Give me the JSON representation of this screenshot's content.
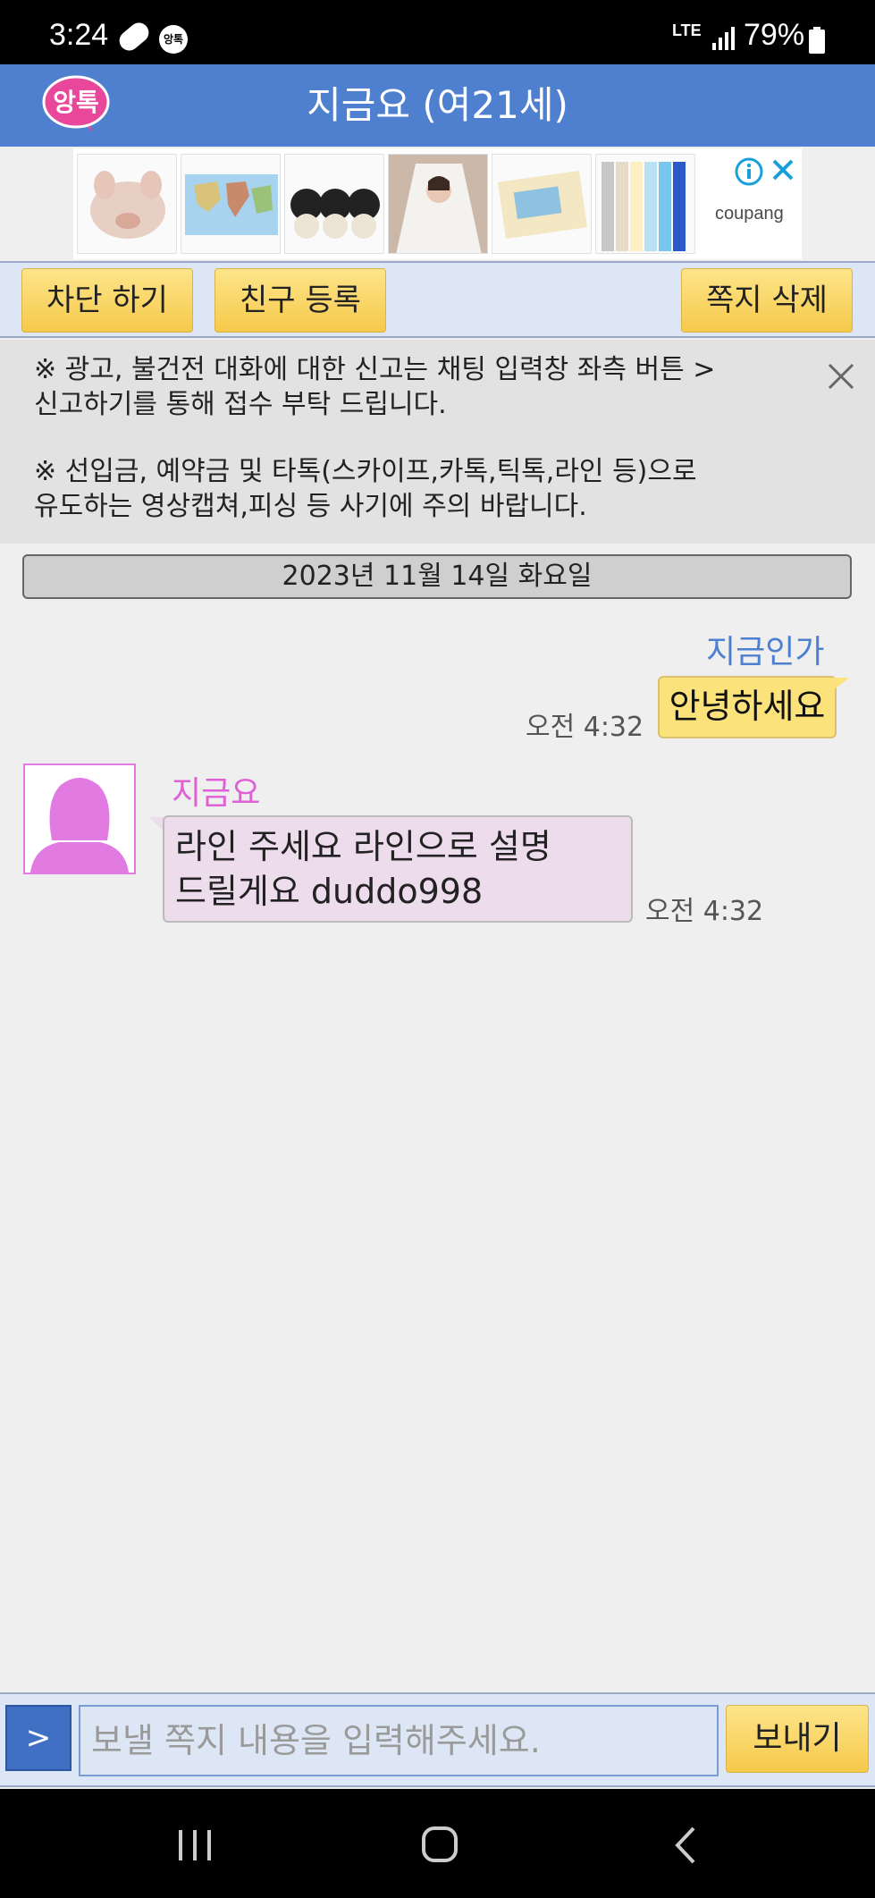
{
  "status_bar": {
    "time": "3:24",
    "app_badge": "앙톡",
    "network": "LTE",
    "battery": "79%"
  },
  "header": {
    "logo_text": "앙톡",
    "title": "지금요 (여21세)"
  },
  "ad": {
    "brand": "coupang",
    "items": [
      "pig-figurine",
      "world-map",
      "makeup-cushions",
      "bride-photo",
      "craft-kit",
      "ribbon-rolls"
    ]
  },
  "toolbar": {
    "block_label": "차단 하기",
    "add_friend_label": "친구 등록",
    "delete_label": "쪽지 삭제"
  },
  "notice": {
    "line1": "※ 광고, 불건전 대화에 대한 신고는 채팅 입력창 좌측 버튼 >",
    "line2": "신고하기를 통해 접수 부탁 드립니다.",
    "line3": "※ 선입금, 예약금 및 타톡(스카이프,카톡,틱톡,라인 등)으로",
    "line4": "유도하는 영상캡쳐,피싱 등 사기에 주의 바랍니다."
  },
  "chat": {
    "date": "2023년 11월 14일 화요일",
    "outgoing": {
      "sender": "지금인가",
      "text": "안녕하세요",
      "time": "오전 4:32"
    },
    "incoming": {
      "sender": "지금요",
      "line1": "라인 주세요 라인으로 설명",
      "line2": "드릴게요 duddo998",
      "time": "오전 4:32"
    }
  },
  "input": {
    "expand_label": ">",
    "placeholder": "보낼 쪽지 내용을 입력해주세요.",
    "send_label": "보내기"
  },
  "colors": {
    "header": "#4f80d0",
    "button_yellow": "#f6c94a",
    "outgoing_bubble": "#fbe27b",
    "incoming_bubble": "#eddcec",
    "incoming_name": "#e060d8",
    "outgoing_name": "#4f80d0"
  }
}
